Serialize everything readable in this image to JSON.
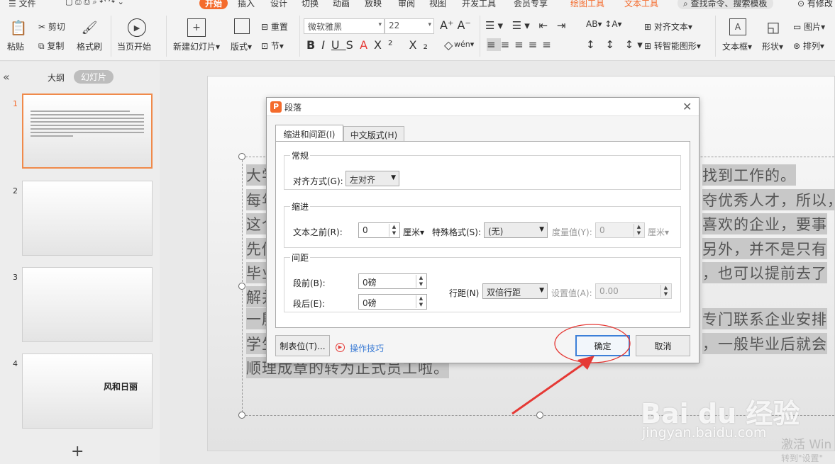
{
  "menu": {
    "file": "文件",
    "items": [
      "开始",
      "插入",
      "设计",
      "切换",
      "动画",
      "放映",
      "审阅",
      "视图",
      "开发工具",
      "会员专享"
    ],
    "context_tabs": [
      "绘图工具",
      "文本工具"
    ],
    "search": "查找命令、搜索模板",
    "right_text": "有修改"
  },
  "toolbar": {
    "paste": "粘贴",
    "cut": "剪切",
    "copy": "复制",
    "format_painter": "格式刷",
    "start_from_current": "当页开始",
    "new_slide": "新建幻灯片",
    "layout": "版式",
    "reset": "重置",
    "section": "节",
    "font_name": "微软雅黑",
    "font_size": "22",
    "align_text": "对齐文本",
    "smart_art": "转智能图形",
    "text_box": "文本框",
    "shape": "形状",
    "picture": "图片",
    "arrange": "排列"
  },
  "left_panel": {
    "tab_outline": "大纲",
    "tab_slides": "幻灯片",
    "slides": [
      {
        "num": "1",
        "text": ""
      },
      {
        "num": "2",
        "text": ""
      },
      {
        "num": "3",
        "text": ""
      },
      {
        "num": "4",
        "text": "风和日丽"
      }
    ],
    "add_label": "+"
  },
  "slide": {
    "lines": [
      {
        "left": "大学",
        "right": "找到工作的。"
      },
      {
        "left": "每年",
        "right": "夺优秀人才，所以，"
      },
      {
        "left": "这个",
        "right": "喜欢的企业，要事"
      },
      {
        "left": "先做",
        "right": "另外，并不是只有"
      },
      {
        "left": "毕业",
        "right": "，也可以提前去了"
      },
      {
        "left": "解并",
        "right": ""
      },
      {
        "left": "一殷",
        "right": "专门联系企业安排"
      },
      {
        "left": "学生",
        "right": "，一般毕业后就会"
      },
      {
        "left": "顺理成章的转为正式员工啦。",
        "right": ""
      }
    ],
    "watermark_logo": "Bai du 经验",
    "watermark_url": "jingyan.baidu.com",
    "activate_line1": "激活 Win",
    "activate_line2": "转到\"设置\""
  },
  "dialog": {
    "title": "段落",
    "tabs": [
      "缩进和间距(I)",
      "中文版式(H)"
    ],
    "general": {
      "title": "常规",
      "align_label": "对齐方式(G):",
      "align_value": "左对齐"
    },
    "indent": {
      "title": "缩进",
      "before_label": "文本之前(R):",
      "before_value": "0",
      "before_unit": "厘米",
      "special_label": "特殊格式(S):",
      "special_value": "(无)",
      "measure_label": "度量值(Y):",
      "measure_value": "0",
      "measure_unit": "厘米"
    },
    "spacing": {
      "title": "间距",
      "before_label": "段前(B):",
      "before_value": "0磅",
      "after_label": "段后(E):",
      "after_value": "0磅",
      "line_label": "行距(N)",
      "line_value": "双倍行距",
      "set_label": "设置值(A):",
      "set_value": "0.00"
    },
    "tabs_button": "制表位(T)...",
    "tips_link": "操作技巧",
    "ok": "确定",
    "cancel": "取消"
  },
  "colors": {
    "accent": "#f46b2c",
    "annotation": "#e53935"
  }
}
